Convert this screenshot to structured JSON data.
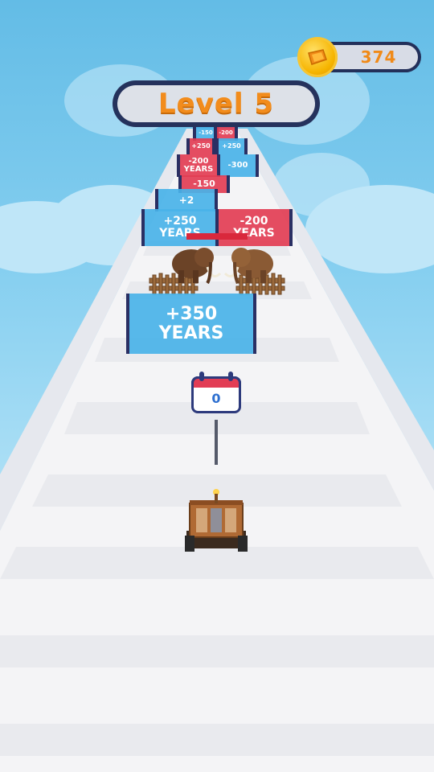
{
  "hud": {
    "coins": "374",
    "level_label": "Level 5"
  },
  "gates": {
    "near_left": {
      "line1": "+350",
      "line2": "YEARS"
    },
    "mid_left": {
      "line1": "+250",
      "line2": "YEARS"
    },
    "mid_right": {
      "line1": "-200",
      "line2": "YEARS"
    },
    "far_left_1": {
      "line1": "+2",
      "line2": ""
    },
    "far_right_1": {
      "line1": "-150",
      "line2": ""
    },
    "far_left_2": {
      "line1": "-200",
      "line2": "YEARS"
    },
    "far_right_2": {
      "line1": "-300",
      "line2": ""
    },
    "far_left_3": {
      "line1": "+250",
      "line2": ""
    },
    "far_right_3": {
      "line1": "+250",
      "line2": ""
    },
    "far_left_4": {
      "line1": "-150",
      "line2": ""
    },
    "far_right_4": {
      "line1": "-200",
      "line2": ""
    }
  },
  "player": {
    "calendar_value": "0"
  },
  "colors": {
    "sky": "#6fc3ea",
    "gate_positive": "#49b2e8",
    "gate_negative": "#e23d55",
    "accent_orange": "#f28c1c",
    "panel_dark": "#25325c"
  }
}
